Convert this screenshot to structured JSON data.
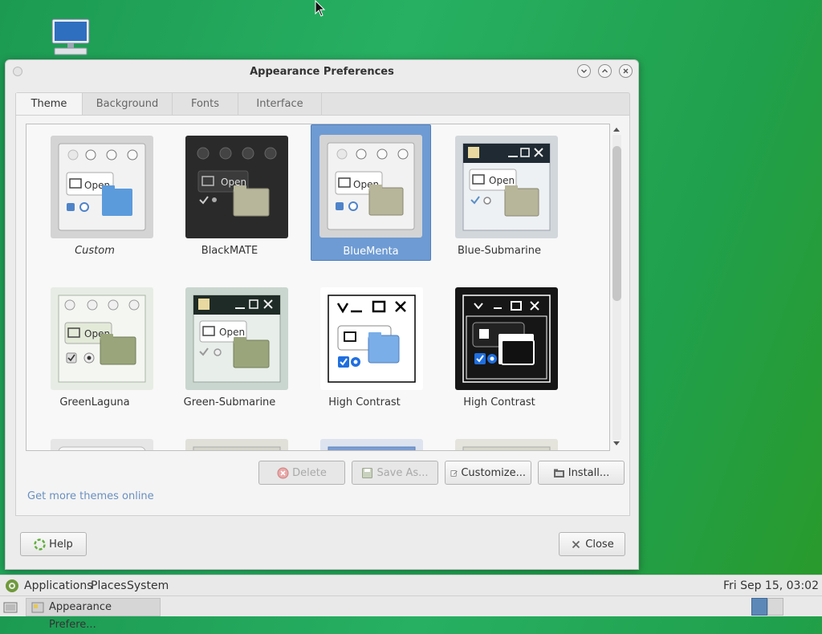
{
  "window": {
    "title": "Appearance Preferences"
  },
  "tabs": [
    {
      "label": "Theme",
      "active": true
    },
    {
      "label": "Background",
      "active": false
    },
    {
      "label": "Fonts",
      "active": false
    },
    {
      "label": "Interface",
      "active": false
    }
  ],
  "themes": [
    {
      "name": "Custom",
      "selected": false
    },
    {
      "name": "BlackMATE",
      "selected": false
    },
    {
      "name": "BlueMenta",
      "selected": true
    },
    {
      "name": "Blue-Submarine",
      "selected": false
    },
    {
      "name": "GreenLaguna",
      "selected": false
    },
    {
      "name": "Green-Submarine",
      "selected": false
    },
    {
      "name": "High Contrast",
      "selected": false
    },
    {
      "name": "High Contrast",
      "selected": false
    }
  ],
  "thumb_text": "Open",
  "buttons": {
    "delete": "Delete",
    "save_as": "Save As...",
    "customize": "Customize...",
    "install": "Install...",
    "help": "Help",
    "close": "Close"
  },
  "link": "Get more themes online",
  "panel": {
    "menus": [
      "Applications",
      "Places",
      "System"
    ],
    "clock": "Fri Sep 15, 03:02",
    "task": "Appearance Prefere..."
  },
  "colors": {
    "selection": "#6e9bd3",
    "desktop": "#22a956",
    "link": "#6a8fc0"
  }
}
